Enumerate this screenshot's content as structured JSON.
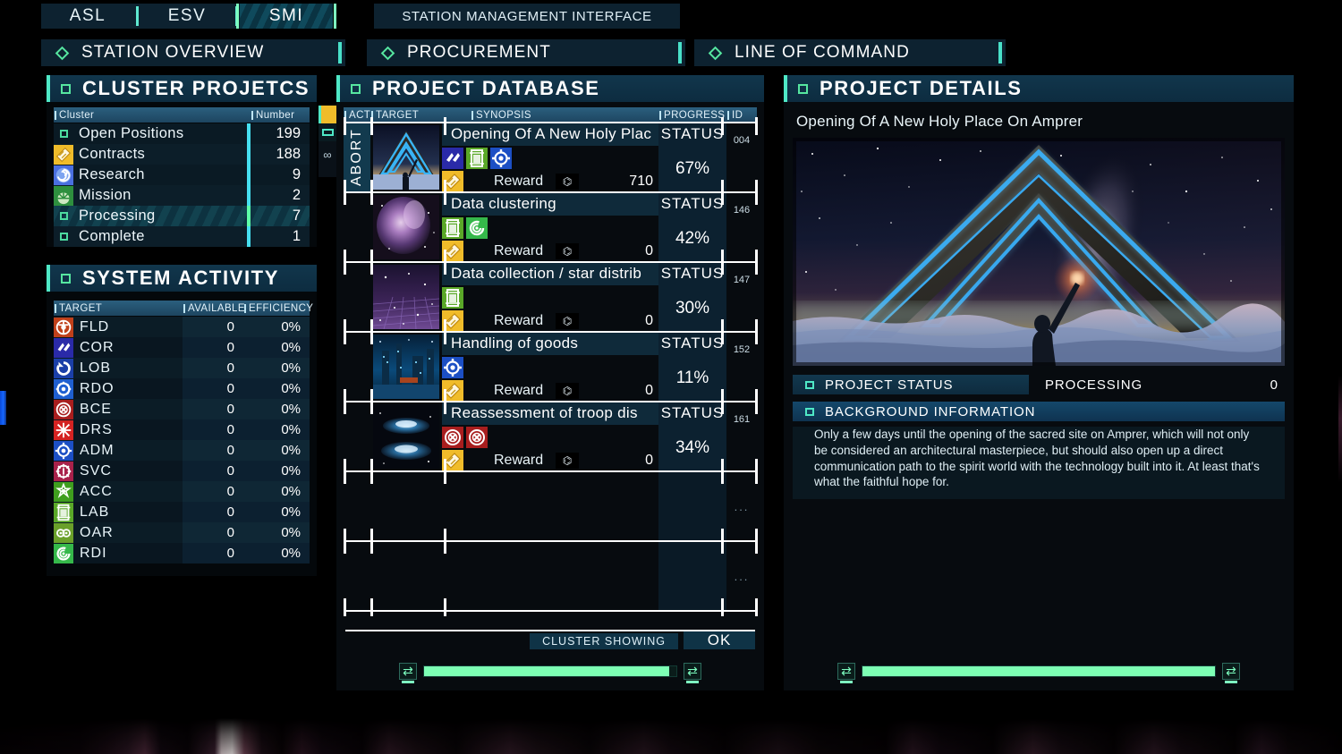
{
  "topbar": {
    "tabs": [
      {
        "label": "ASL",
        "selected": false
      },
      {
        "label": "ESV",
        "selected": false
      },
      {
        "label": "SMI",
        "selected": true
      }
    ],
    "title": "STATION MANAGEMENT INTERFACE"
  },
  "nav": {
    "items": [
      {
        "label": "STATION OVERVIEW"
      },
      {
        "label": "PROCUREMENT"
      },
      {
        "label": "LINE OF COMMAND"
      }
    ]
  },
  "cluster_panel": {
    "title": "CLUSTER PROJETCS",
    "columns": {
      "name": "Cluster",
      "number": "Number"
    },
    "rows": [
      {
        "icon": "small-square-icon",
        "label": "Open Positions",
        "number": "199",
        "selected": false
      },
      {
        "icon": "contract-ticket-icon",
        "label": "Contracts",
        "number": "188",
        "selected": false
      },
      {
        "icon": "research-spiral-icon",
        "label": "Research",
        "number": "9",
        "selected": false
      },
      {
        "icon": "mission-sunburst-icon",
        "label": "Mission",
        "number": "2",
        "selected": false
      },
      {
        "icon": "small-square-icon",
        "label": "Processing",
        "number": "7",
        "selected": true
      },
      {
        "icon": "small-square-icon",
        "label": "Complete",
        "number": "1",
        "selected": false
      }
    ]
  },
  "mini_strip": {
    "items": [
      "contract-ticket-icon",
      "outline-box-icon",
      "infinity-symbol"
    ],
    "infinity": "∞"
  },
  "system_activity": {
    "title": "SYSTEM ACTIVITY",
    "columns": {
      "target": "TARGET",
      "available": "AVAILABLE",
      "efficiency": "EFFICIENCY"
    },
    "rows": [
      {
        "icon": "fld-icon",
        "color": "#c0401a",
        "label": "FLD",
        "available": "0",
        "efficiency": "0%"
      },
      {
        "icon": "cor-icon",
        "color": "#2a2aa8",
        "label": "COR",
        "available": "0",
        "efficiency": "0%"
      },
      {
        "icon": "lob-icon",
        "color": "#1b3fa8",
        "label": "LOB",
        "available": "0",
        "efficiency": "0%"
      },
      {
        "icon": "rdo-icon",
        "color": "#1f5fd0",
        "label": "RDO",
        "available": "0",
        "efficiency": "0%"
      },
      {
        "icon": "bce-icon",
        "color": "#a81e1e",
        "label": "BCE",
        "available": "0",
        "efficiency": "0%"
      },
      {
        "icon": "drs-icon",
        "color": "#d42222",
        "label": "DRS",
        "available": "0",
        "efficiency": "0%"
      },
      {
        "icon": "adm-icon",
        "color": "#1c4fc4",
        "label": "ADM",
        "available": "0",
        "efficiency": "0%"
      },
      {
        "icon": "svc-icon",
        "color": "#a8214a",
        "label": "SVC",
        "available": "0",
        "efficiency": "0%"
      },
      {
        "icon": "acc-icon",
        "color": "#3f9e1e",
        "label": "ACC",
        "available": "0",
        "efficiency": "0%"
      },
      {
        "icon": "lab-icon",
        "color": "#5aa828",
        "label": "LAB",
        "available": "0",
        "efficiency": "0%"
      },
      {
        "icon": "oar-icon",
        "color": "#6aa02a",
        "label": "OAR",
        "available": "0",
        "efficiency": "0%"
      },
      {
        "icon": "rdi-icon",
        "color": "#35b84a",
        "label": "RDI",
        "available": "0",
        "efficiency": "0%"
      }
    ]
  },
  "project_database": {
    "title": "PROJECT DATABASE",
    "columns": {
      "act": "ACT",
      "target": "TARGET",
      "synopsis": "SYNOPSIS",
      "progress": "PROGRESS",
      "id": "ID"
    },
    "rows": [
      {
        "act": "ABORT",
        "thumb": "holy-place-thumb",
        "title": "Opening Of A New Holy Plac",
        "tags": [
          "cor-icon",
          "lab-icon",
          "adm-icon"
        ],
        "reward_label": "Reward",
        "reward_value": "710",
        "status_label": "STATUS",
        "progress": "67%",
        "id": "004",
        "selected": true
      },
      {
        "act": "",
        "thumb": "nebula-thumb",
        "title": "Data clustering",
        "tags": [
          "lab-icon",
          "rdi-icon"
        ],
        "reward_label": "Reward",
        "reward_value": "0",
        "status_label": "STATUS",
        "progress": "42%",
        "id": "146",
        "selected": false
      },
      {
        "act": "",
        "thumb": "starfield-thumb",
        "title": "Data collection / star distrib",
        "tags": [
          "lab-icon"
        ],
        "reward_label": "Reward",
        "reward_value": "0",
        "status_label": "STATUS",
        "progress": "30%",
        "id": "147",
        "selected": false
      },
      {
        "act": "",
        "thumb": "station-thumb",
        "title": "Handling of goods",
        "tags": [
          "adm-icon"
        ],
        "reward_label": "Reward",
        "reward_value": "0",
        "status_label": "STATUS",
        "progress": "11%",
        "id": "152",
        "selected": false
      },
      {
        "act": "",
        "thumb": "fleet-thumb",
        "title": "Reassessment of troop dis",
        "tags": [
          "bce-icon",
          "bce-icon"
        ],
        "reward_label": "Reward",
        "reward_value": "0",
        "status_label": "STATUS",
        "progress": "34%",
        "id": "161",
        "selected": false
      },
      {
        "empty": true,
        "id": "..."
      },
      {
        "empty": true,
        "id": "..."
      }
    ],
    "footer": {
      "cluster_showing": "CLUSTER SHOWING",
      "ok": "OK"
    },
    "scrollbar": {
      "fill_percent": 97,
      "left_glyph": "⇄",
      "right_glyph": "⇄"
    }
  },
  "project_details": {
    "title": "PROJECT DETAILS",
    "project_title": "Opening Of A New Holy Place On Amprer",
    "image_name": "holy-place-artwork",
    "status": {
      "label": "PROJECT STATUS",
      "value": "PROCESSING",
      "number": "0"
    },
    "background": {
      "label": "BACKGROUND INFORMATION",
      "text": "Only a few days until the opening of the sacred site on Amprer, which will not only be considered an architectural masterpiece, but should also open up a direct communication path to the spirit world with the technology built into it. At least that's what the faithful hope for."
    },
    "scrollbar": {
      "fill_percent": 100,
      "left_glyph": "⇄",
      "right_glyph": "⇄"
    }
  },
  "colors": {
    "accent_green": "#4fe8c6",
    "accent_cyan": "#46dff0",
    "panel_header": "#11364c",
    "table_header": "#2b5f7e",
    "scroll_fill": "#7dffb4",
    "gold": "#f0bc2a"
  }
}
